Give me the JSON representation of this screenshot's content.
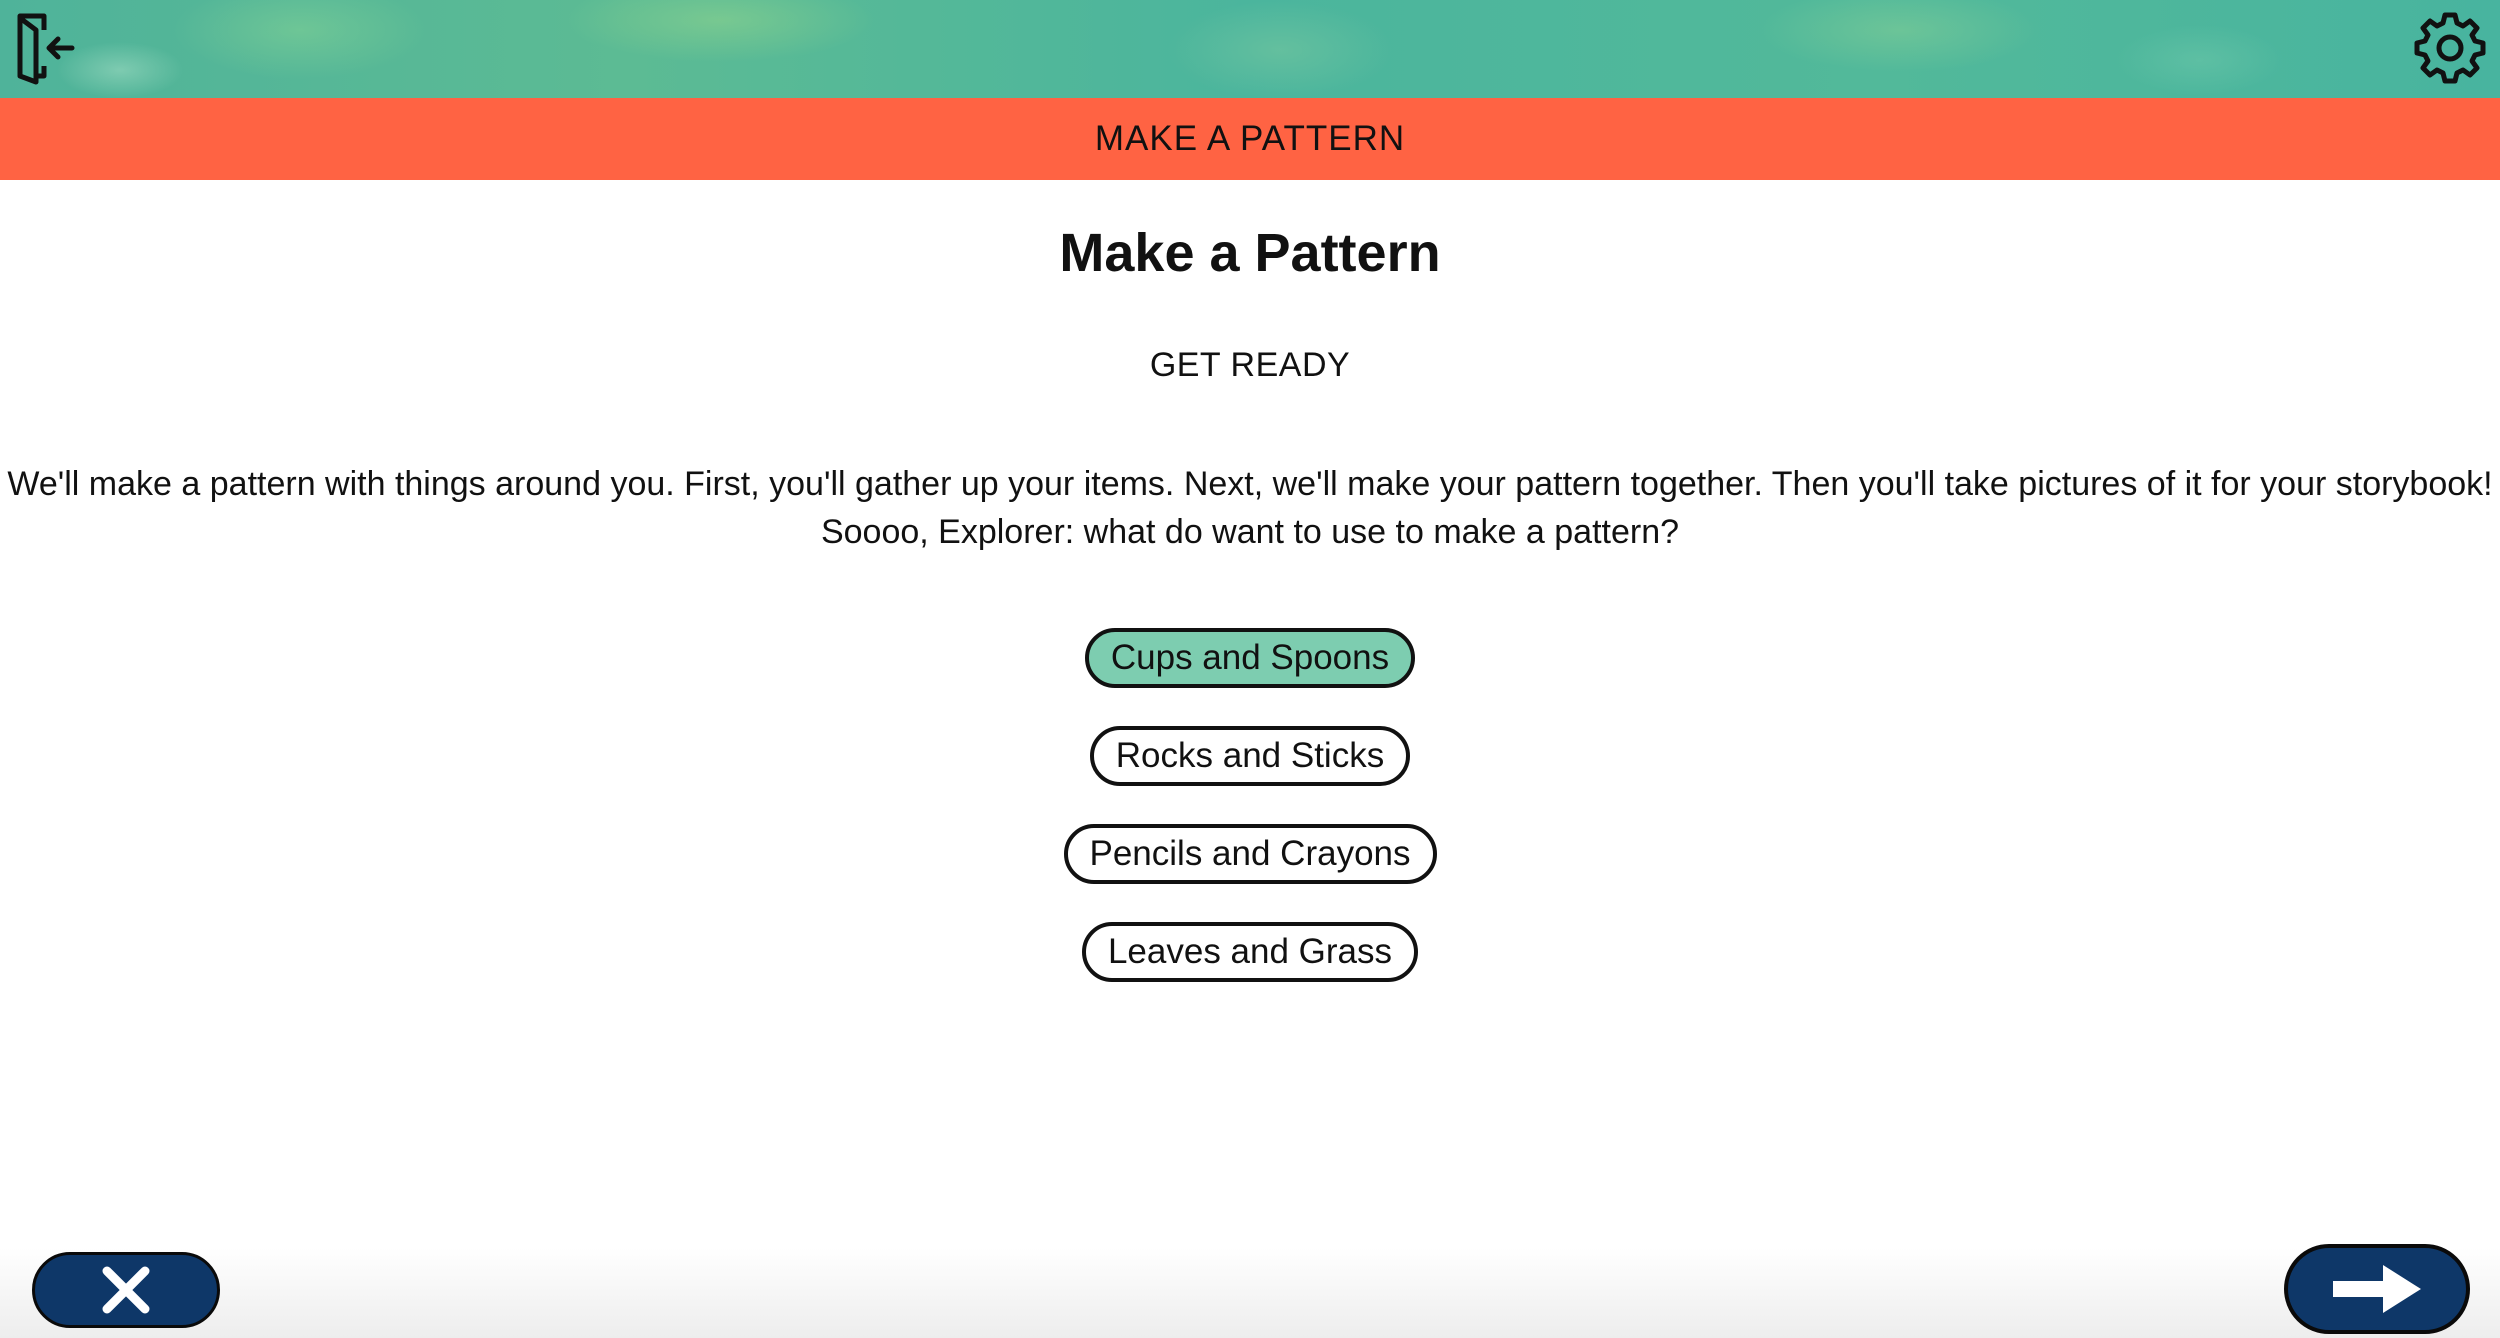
{
  "header": {
    "exit_icon": "exit-door-icon",
    "settings_icon": "gear-icon",
    "banner_title": "MAKE A PATTERN"
  },
  "main": {
    "title": "Make a Pattern",
    "subtitle": "GET READY",
    "description": "We'll make a pattern with things around you. First, you'll gather up your items. Next, we'll make your pattern together. Then you'll take pictures of it for your storybook! Soooo, Explorer: what do want to use to make a pattern?",
    "options": [
      {
        "label": "Cups and Spoons",
        "selected": true
      },
      {
        "label": "Rocks and Sticks",
        "selected": false
      },
      {
        "label": "Pencils and Crayons",
        "selected": false
      },
      {
        "label": "Leaves and Grass",
        "selected": false
      }
    ]
  },
  "footer": {
    "close_icon": "close-icon",
    "next_icon": "arrow-right-icon"
  },
  "colors": {
    "banner": "#4fb39a",
    "title_bar": "#ff6343",
    "selected_option": "#7dcdb0",
    "nav_button": "#0e3768"
  }
}
